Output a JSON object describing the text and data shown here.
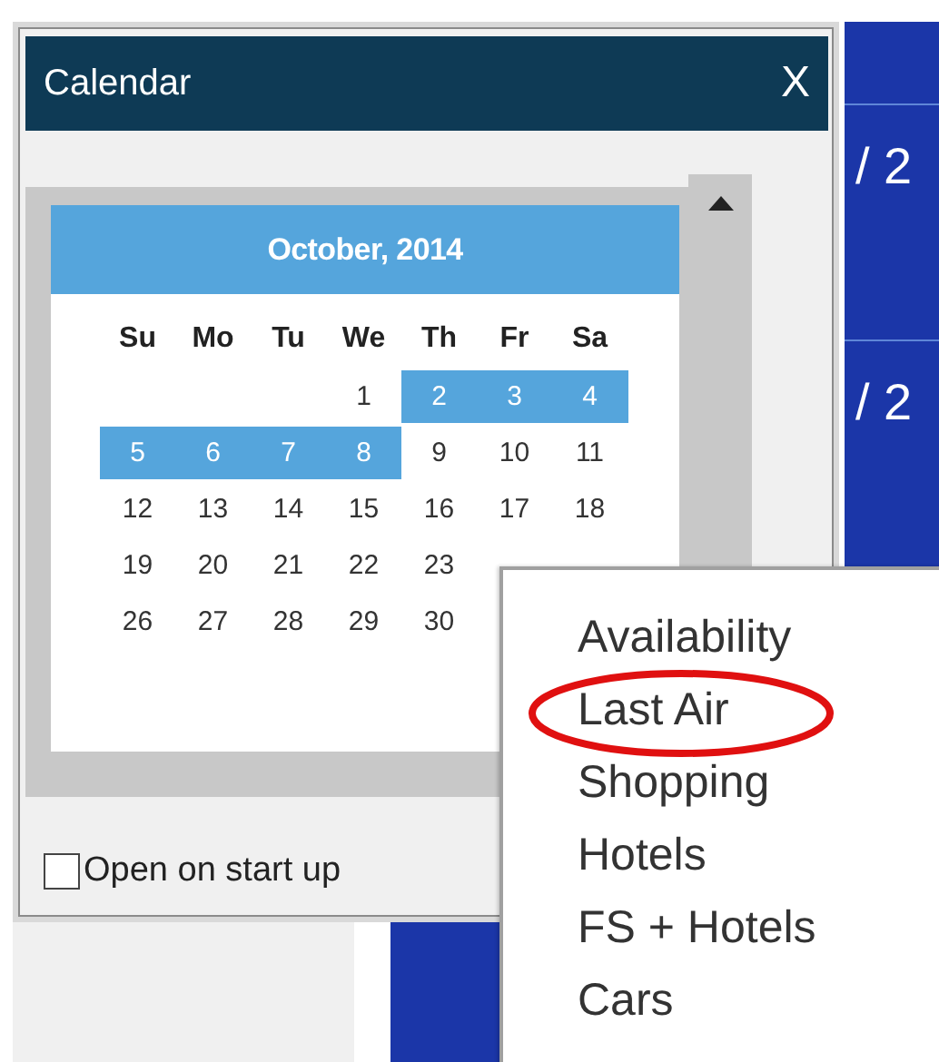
{
  "calendar_window": {
    "title": "Calendar",
    "close": "X",
    "month": "October, 2014",
    "weekdays": [
      "Su",
      "Mo",
      "Tu",
      "We",
      "Th",
      "Fr",
      "Sa"
    ],
    "weeks": [
      [
        {
          "kind": "empty"
        },
        {
          "kind": "empty"
        },
        {
          "kind": "empty"
        },
        {
          "kind": "day",
          "day": "1",
          "selected": false
        },
        {
          "day": "2",
          "selected": true
        },
        {
          "day": "3",
          "selected": true
        },
        {
          "day": "4",
          "selected": true
        }
      ],
      [
        {
          "day": "5",
          "selected": true
        },
        {
          "day": "6",
          "selected": true
        },
        {
          "day": "7",
          "selected": true
        },
        {
          "day": "8",
          "selected": true
        },
        {
          "day": "9",
          "selected": false
        },
        {
          "day": "10",
          "selected": false
        },
        {
          "day": "11",
          "selected": false
        }
      ],
      [
        {
          "day": "12",
          "selected": false
        },
        {
          "day": "13",
          "selected": false
        },
        {
          "day": "14",
          "selected": false
        },
        {
          "day": "15",
          "selected": false
        },
        {
          "day": "16",
          "selected": false
        },
        {
          "day": "17",
          "selected": false
        },
        {
          "day": "18",
          "selected": false
        }
      ],
      [
        {
          "day": "19",
          "selected": false
        },
        {
          "day": "20",
          "selected": false
        },
        {
          "day": "21",
          "selected": false
        },
        {
          "day": "22",
          "selected": false
        },
        {
          "day": "23",
          "selected": false
        }
      ],
      [
        {
          "day": "26",
          "selected": false
        },
        {
          "day": "27",
          "selected": false
        },
        {
          "day": "28",
          "selected": false
        },
        {
          "day": "29",
          "selected": false
        },
        {
          "day": "30",
          "selected": false
        }
      ]
    ],
    "open_on_startup": {
      "label": "Open on start up",
      "checked": false
    }
  },
  "terminal": {
    "lines": [
      "/ 2",
      "/ 2"
    ]
  },
  "context_menu": {
    "items": [
      {
        "label": "Availability",
        "circled": false
      },
      {
        "label": "Last Air",
        "circled": true
      },
      {
        "label": "Shopping",
        "circled": false
      },
      {
        "label": "Hotels",
        "circled": false
      },
      {
        "label": "FS + Hotels",
        "circled": false
      },
      {
        "label": "Cars",
        "circled": false
      }
    ]
  }
}
